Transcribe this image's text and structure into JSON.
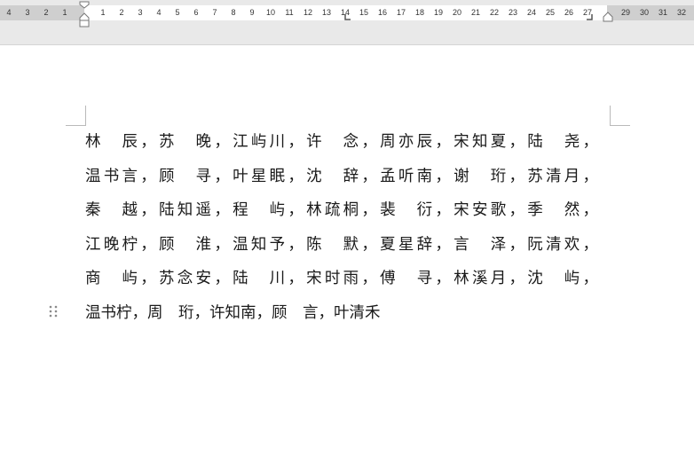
{
  "ruler": {
    "left_ticks": [
      "4",
      "3",
      "2",
      "1"
    ],
    "right_ticks": [
      "1",
      "2",
      "3",
      "4",
      "5",
      "6",
      "7",
      "8",
      "9",
      "10",
      "11",
      "12",
      "13",
      "14",
      "15",
      "16",
      "17",
      "18",
      "19",
      "20",
      "21",
      "22",
      "23",
      "24",
      "25",
      "26",
      "27"
    ],
    "margin_ticks": [
      "29",
      "30",
      "31",
      "32"
    ]
  },
  "document": {
    "lines": [
      "林　辰，苏　晚，江屿川，许　念，周亦辰，宋知夏，陆　尧，",
      "温书言，顾　寻，叶星眠，沈　辞，孟听南，谢　珩，苏清月，",
      "秦　越，陆知遥，程　屿，林疏桐，裴　衍，宋安歌，季　然，",
      "江晚柠，顾　淮，温知予，陈　默，夏星辞，言　泽，阮清欢，",
      "商　屿，苏念安，陆　川，宋时雨，傅　寻，林溪月，沈　屿，",
      "温书柠，周　珩，许知南，顾　言，叶清禾"
    ]
  },
  "icons": {
    "paragraph_handle": "drag-handle-icon",
    "first_line_indent": "indent-marker-icon",
    "right_indent": "right-indent-icon"
  }
}
